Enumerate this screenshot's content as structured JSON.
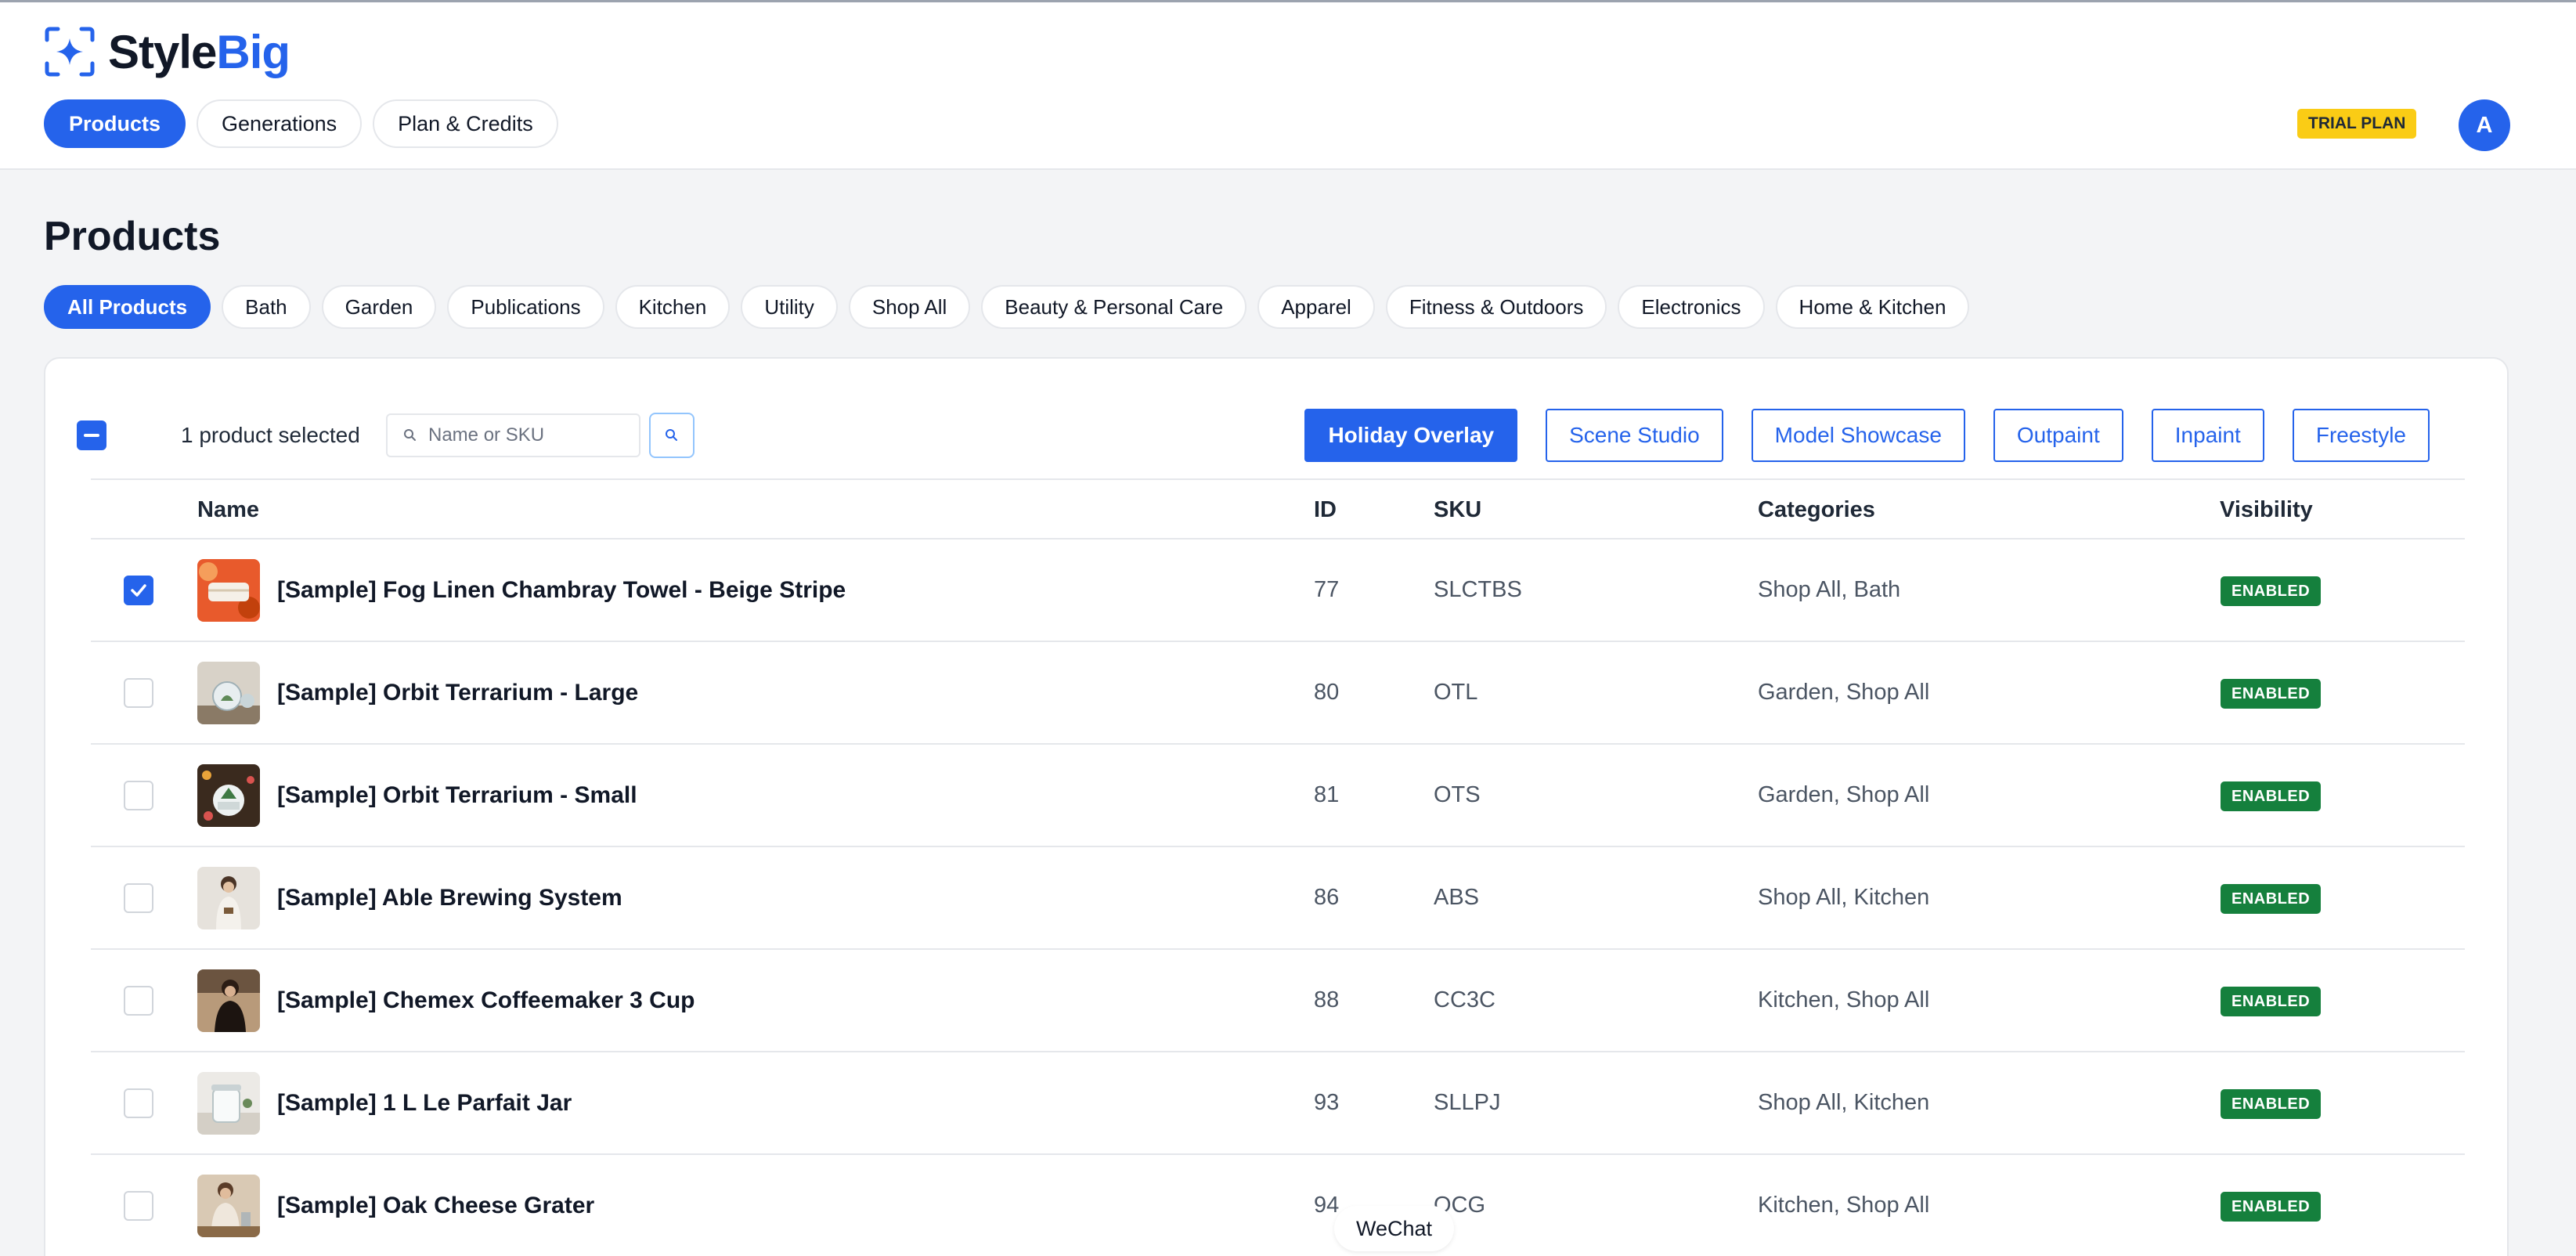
{
  "brand": {
    "name_part1": "Style",
    "name_part2": "Big",
    "accent": "#2563eb"
  },
  "nav": [
    "Products",
    "Generations",
    "Plan & Credits"
  ],
  "plan_badge": "TRIAL PLAN",
  "avatar_initial": "A",
  "page_title": "Products",
  "categories": [
    "All Products",
    "Bath",
    "Garden",
    "Publications",
    "Kitchen",
    "Utility",
    "Shop All",
    "Beauty & Personal Care",
    "Apparel",
    "Fitness & Outdoors",
    "Electronics",
    "Home & Kitchen"
  ],
  "selection_text": "1 product selected",
  "search": {
    "placeholder": "Name or SKU"
  },
  "actions": [
    "Holiday Overlay",
    "Scene Studio",
    "Model Showcase",
    "Outpaint",
    "Inpaint",
    "Freestyle"
  ],
  "columns": {
    "name": "Name",
    "id": "ID",
    "sku": "SKU",
    "categories": "Categories",
    "visibility": "Visibility"
  },
  "rows": [
    {
      "name": "[Sample] Fog Linen Chambray Towel - Beige Stripe",
      "id": "77",
      "sku": "SLCTBS",
      "categories": "Shop All, Bath",
      "visibility": "ENABLED",
      "checked": true
    },
    {
      "name": "[Sample] Orbit Terrarium - Large",
      "id": "80",
      "sku": "OTL",
      "categories": "Garden, Shop All",
      "visibility": "ENABLED",
      "checked": false
    },
    {
      "name": "[Sample] Orbit Terrarium - Small",
      "id": "81",
      "sku": "OTS",
      "categories": "Garden, Shop All",
      "visibility": "ENABLED",
      "checked": false
    },
    {
      "name": "[Sample] Able Brewing System",
      "id": "86",
      "sku": "ABS",
      "categories": "Shop All, Kitchen",
      "visibility": "ENABLED",
      "checked": false
    },
    {
      "name": "[Sample] Chemex Coffeemaker 3 Cup",
      "id": "88",
      "sku": "CC3C",
      "categories": "Kitchen, Shop All",
      "visibility": "ENABLED",
      "checked": false
    },
    {
      "name": "[Sample] 1 L Le Parfait Jar",
      "id": "93",
      "sku": "SLLPJ",
      "categories": "Shop All, Kitchen",
      "visibility": "ENABLED",
      "checked": false
    },
    {
      "name": "[Sample] Oak Cheese Grater",
      "id": "94",
      "sku": "OCG",
      "categories": "Kitchen, Shop All",
      "visibility": "ENABLED",
      "checked": false
    }
  ],
  "chat_widget": "WeChat"
}
